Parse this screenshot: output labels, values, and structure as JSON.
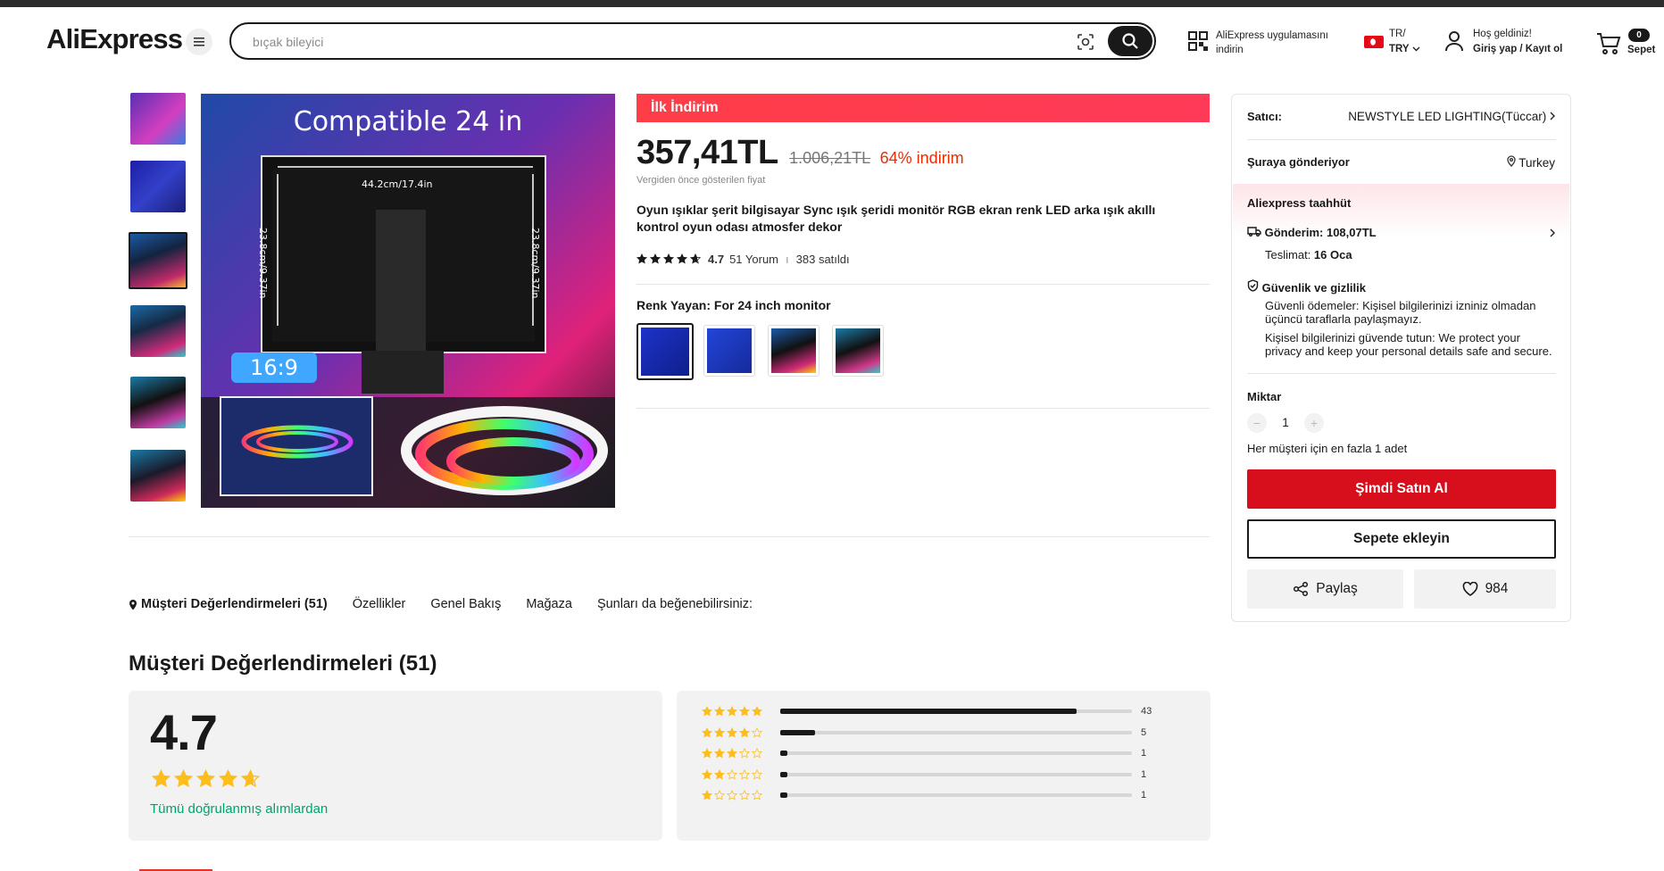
{
  "header": {
    "logo": "AliExpress",
    "search_placeholder": "bıçak bileyici",
    "app_download": "AliExpress uygulamasını indirin",
    "lang_line1": "TR/",
    "lang_line2": "TRY",
    "greeting": "Hoş geldiniz!",
    "login": "Giriş yap / Kayıt ol",
    "cart_count": "0",
    "cart_label": "Sepet"
  },
  "gallery": {
    "main_caption": "Compatible 24 in",
    "ratio_label": "16:9",
    "width_label": "44.2cm/17.4in",
    "height_label": "23.8cm/9.37in"
  },
  "product": {
    "promo": "İlk İndirim",
    "price_now": "357,41TL",
    "price_old": "1.006,21TL",
    "discount": "64% indirim",
    "price_note": "Vergiden önce gösterilen fiyat",
    "title": "Oyun ışıklar şerit bilgisayar Sync ışık şeridi monitör RGB ekran renk LED arka ışık akıllı kontrol oyun odası atmosfer dekor",
    "rating": "4.7",
    "reviews_link": "51 Yorum",
    "sold": "383 satıldı",
    "color_label": "Renk Yayan: For 24 inch monitor"
  },
  "panel": {
    "seller_label": "Satıcı:",
    "seller_name": "NEWSTYLE LED LIGHTING(Tüccar)",
    "ship_label": "Şuraya gönderiyor",
    "ship_dest": "Turkey",
    "promise_title": "Aliexpress taahhüt",
    "delivery_line": "Gönderim: 108,07TL",
    "delivery_label": "Teslimat:",
    "delivery_date": "16 Oca",
    "security_title": "Güvenlik ve gizlilik",
    "security_note1": "Güvenli ödemeler: Kişisel bilgilerinizi izniniz olmadan üçüncü taraflarla paylaşmayız.",
    "security_note2": "Kişisel bilgilerinizi güvende tutun: We protect your privacy and keep your personal details safe and secure.",
    "qty_label": "Miktar",
    "qty_value": "1",
    "qty_note": "Her müşteri için en fazla 1 adet",
    "buy_now": "Şimdi Satın Al",
    "add_to_cart": "Sepete ekleyin",
    "share": "Paylaş",
    "wishlist_count": "984"
  },
  "tabs": [
    "Müşteri Değerlendirmeleri (51)",
    "Özellikler",
    "Genel Bakış",
    "Mağaza",
    "Şunları da beğenebilirsiniz:"
  ],
  "reviews": {
    "title": "Müşteri Değerlendirmeleri (51)",
    "average": "4.7",
    "average_value": 4.7,
    "verified": "Tümü doğrulanmış alımlardan",
    "distribution": [
      {
        "stars": 5,
        "count": "43",
        "fraction": 0.843
      },
      {
        "stars": 4,
        "count": "5",
        "fraction": 0.098
      },
      {
        "stars": 3,
        "count": "1",
        "fraction": 0.02
      },
      {
        "stars": 2,
        "count": "1",
        "fraction": 0.02
      },
      {
        "stars": 1,
        "count": "1",
        "fraction": 0.02
      }
    ]
  },
  "colors": {
    "accent_red": "#d70f1d",
    "promo_red": "#ff3d47",
    "discount_red": "#e62e04",
    "star_gold": "#fdbd1c",
    "verified_green": "#00a36c"
  }
}
